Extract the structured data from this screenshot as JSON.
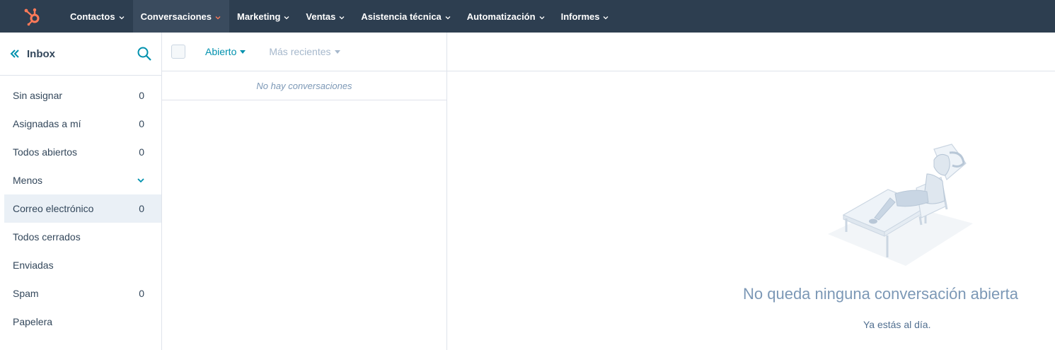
{
  "topnav": {
    "logo": "hubspot-sprocket-icon",
    "items": [
      {
        "label": "Contactos"
      },
      {
        "label": "Conversaciones",
        "active": true
      },
      {
        "label": "Marketing"
      },
      {
        "label": "Ventas"
      },
      {
        "label": "Asistencia técnica"
      },
      {
        "label": "Automatización"
      },
      {
        "label": "Informes"
      }
    ]
  },
  "sidebar": {
    "title": "Inbox",
    "items": [
      {
        "label": "Sin asignar",
        "count": "0"
      },
      {
        "label": "Asignadas a mí",
        "count": "0"
      },
      {
        "label": "Todos abiertos",
        "count": "0"
      },
      {
        "label": "Menos",
        "count": ""
      },
      {
        "label": "Correo electrónico",
        "count": "0"
      },
      {
        "label": "Todos cerrados",
        "count": ""
      },
      {
        "label": "Enviadas",
        "count": ""
      },
      {
        "label": "Spam",
        "count": "0"
      },
      {
        "label": "Papelera",
        "count": ""
      }
    ]
  },
  "listpane": {
    "filter_status": "Abierto",
    "filter_sort": "Más recientes",
    "empty_message": "No hay conversaciones"
  },
  "detail": {
    "empty_title": "No queda ninguna conversación abierta",
    "empty_subtitle": "Ya estás al día."
  },
  "colors": {
    "nav_bg": "#2d3e50",
    "accent": "#0091ae",
    "logo_orange": "#ff7a59",
    "active_bg": "#eaf0f6"
  }
}
